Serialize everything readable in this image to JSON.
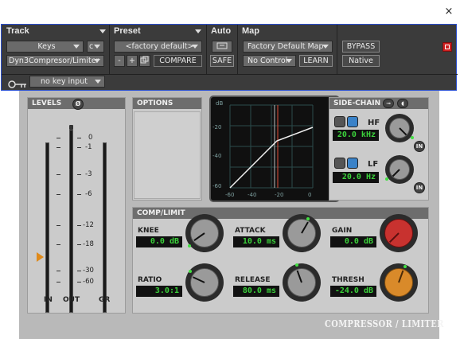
{
  "window": {
    "close_label": "×"
  },
  "header": {
    "track": {
      "title": "Track",
      "name": "Keys",
      "channel": "c",
      "plugin": "Dyn3Compresor/Limiter"
    },
    "preset": {
      "title": "Preset",
      "name": "<factory default>",
      "minus": "-",
      "plus": "+",
      "compare": "COMPARE"
    },
    "auto": {
      "title": "Auto",
      "safe": "SAFE"
    },
    "map": {
      "title": "Map",
      "name": "Factory Default Map",
      "control": "No Control",
      "learn": "LEARN"
    },
    "bypass": "BYPASS",
    "native": "Native",
    "key_input": "no key input"
  },
  "levels": {
    "title": "LEVELS",
    "phase_symbol": "Ø",
    "scale": [
      "0",
      "-1",
      "-3",
      "-6",
      "-12",
      "-18",
      "-30",
      "-60"
    ],
    "meters": [
      "IN",
      "OUT",
      "GR"
    ]
  },
  "options": {
    "title": "OPTIONS"
  },
  "graph": {
    "y_ticks": [
      "dB",
      "-20",
      "-40",
      "-60"
    ],
    "x_ticks": [
      "-60",
      "-40",
      "-20",
      "0"
    ]
  },
  "sidechain": {
    "title": "SIDE-CHAIN",
    "hf": {
      "label": "HF",
      "value": "20.0 kHz"
    },
    "lf": {
      "label": "LF",
      "value": "20.0 Hz"
    },
    "in_label": "IN"
  },
  "complimit": {
    "title": "COMP/LIMIT",
    "knee": {
      "label": "KNEE",
      "value": "0.0 dB"
    },
    "attack": {
      "label": "ATTACK",
      "value": "10.0 ms"
    },
    "gain": {
      "label": "GAIN",
      "value": "0.0 dB"
    },
    "ratio": {
      "label": "RATIO",
      "value": "3.0:1"
    },
    "release": {
      "label": "RELEASE",
      "value": "80.0 ms"
    },
    "thresh": {
      "label": "THRESH",
      "value": "-24.0 dB"
    }
  },
  "brand": "COMPRESSOR / LIMITER",
  "colors": {
    "accent_blue": "#2a4fd0",
    "value_green": "#3bd23b",
    "gain_knob": "#c8322f",
    "thresh_knob": "#d98a2a",
    "bypass_red": "#d02020"
  }
}
